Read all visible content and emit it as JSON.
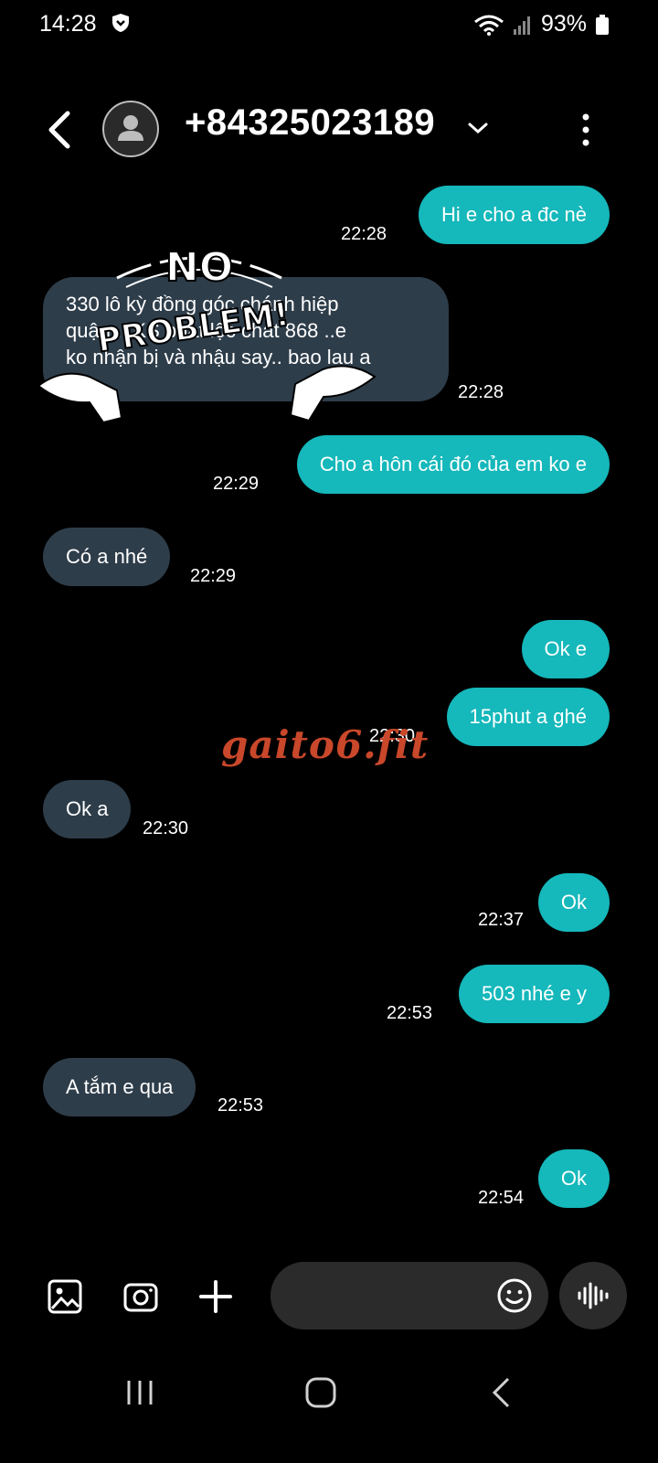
{
  "status": {
    "time": "14:28",
    "battery": "93%"
  },
  "header": {
    "contact": "+84325023189"
  },
  "messages": [
    {
      "dir": "out",
      "text": "Hi e cho a đc nè",
      "time": "22:28"
    },
    {
      "dir": "in",
      "lines": [
        "330 lô kỳ đồng góc chánh hiệp",
        "quận ...KS phát lộc chát 868 ..e",
        "ko nhận bị và nhậu say.. bao lau a"
      ],
      "time": "22:28"
    },
    {
      "dir": "out",
      "text": "Cho a hôn cái đó của em ko e",
      "time": "22:29"
    },
    {
      "dir": "in",
      "text": "Có a nhé",
      "time": "22:29"
    },
    {
      "dir": "out",
      "text": "Ok e",
      "time": ""
    },
    {
      "dir": "out",
      "text": "15phut a ghé",
      "time": "22:30"
    },
    {
      "dir": "in",
      "text": "Ok a",
      "time": "22:30"
    },
    {
      "dir": "out",
      "text": "Ok",
      "time": "22:37"
    },
    {
      "dir": "out",
      "text": "503 nhé e y",
      "time": "22:53"
    },
    {
      "dir": "in",
      "text": "A tắm e qua",
      "time": "22:53"
    },
    {
      "dir": "out",
      "text": "Ok",
      "time": "22:54"
    }
  ],
  "sticker": {
    "text_top": "NO",
    "text_bottom": "PROBLEM!"
  },
  "watermark": "gaito6.fit",
  "colors": {
    "outgoing": "#15b8bb",
    "incoming": "#2e3d4a",
    "watermark": "#c9472a"
  },
  "icons": [
    "back-arrow-icon",
    "avatar-icon",
    "chevron-down-icon",
    "more-vert-icon",
    "gallery-icon",
    "camera-icon",
    "plus-icon",
    "emoji-icon",
    "voice-icon",
    "recents-icon",
    "home-icon",
    "nav-back-icon"
  ]
}
